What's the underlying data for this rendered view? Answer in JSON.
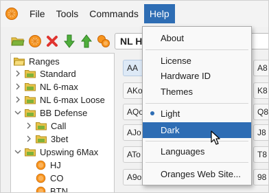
{
  "menubar": {
    "items": [
      {
        "label": "File"
      },
      {
        "label": "Tools"
      },
      {
        "label": "Commands"
      },
      {
        "label": "Help"
      }
    ],
    "active": "Help"
  },
  "range_field": {
    "value": "NL H"
  },
  "tree": {
    "items": [
      {
        "label": "Ranges",
        "depth": 0,
        "kind": "folder",
        "expanded": true
      },
      {
        "label": "Standard",
        "depth": 1,
        "kind": "folder",
        "expanded": false
      },
      {
        "label": "NL 6-max",
        "depth": 1,
        "kind": "folder",
        "expanded": false
      },
      {
        "label": "NL 6-max Loose",
        "depth": 1,
        "kind": "folder",
        "expanded": false
      },
      {
        "label": "BB Defense",
        "depth": 1,
        "kind": "folder",
        "expanded": true
      },
      {
        "label": "Call",
        "depth": 2,
        "kind": "folder",
        "expanded": false
      },
      {
        "label": "3bet",
        "depth": 2,
        "kind": "folder",
        "expanded": false
      },
      {
        "label": "Upswing 6Max",
        "depth": 1,
        "kind": "folder",
        "expanded": true
      },
      {
        "label": "HJ",
        "depth": 2,
        "kind": "range"
      },
      {
        "label": "CO",
        "depth": 2,
        "kind": "range"
      },
      {
        "label": "BTN",
        "depth": 2,
        "kind": "range"
      }
    ]
  },
  "grid": {
    "left_column": [
      "AA",
      "AKo",
      "AQo",
      "AJo",
      "ATo",
      "A9o"
    ],
    "right_column": [
      "A8",
      "K8",
      "Q8",
      "J8",
      "T8",
      "98"
    ]
  },
  "help_menu": {
    "items": [
      {
        "label": "About",
        "type": "item"
      },
      {
        "type": "separator"
      },
      {
        "label": "License",
        "type": "item"
      },
      {
        "label": "Hardware ID",
        "type": "item"
      },
      {
        "label": "Themes",
        "type": "item"
      },
      {
        "type": "separator"
      },
      {
        "label": "Light",
        "type": "radio",
        "checked": true
      },
      {
        "label": "Dark",
        "type": "radio",
        "checked": false,
        "highlighted": true
      },
      {
        "type": "separator"
      },
      {
        "label": "Languages",
        "type": "item"
      },
      {
        "type": "separator"
      },
      {
        "label": "Oranges Web Site...",
        "type": "item"
      }
    ]
  },
  "colors": {
    "accent": "#2e6db4",
    "orange": "#f7941d",
    "folder": "#e8c34a",
    "folder_green": "#7fb23a",
    "delete": "#e0342f",
    "arrow_green": "#4fae3c"
  }
}
